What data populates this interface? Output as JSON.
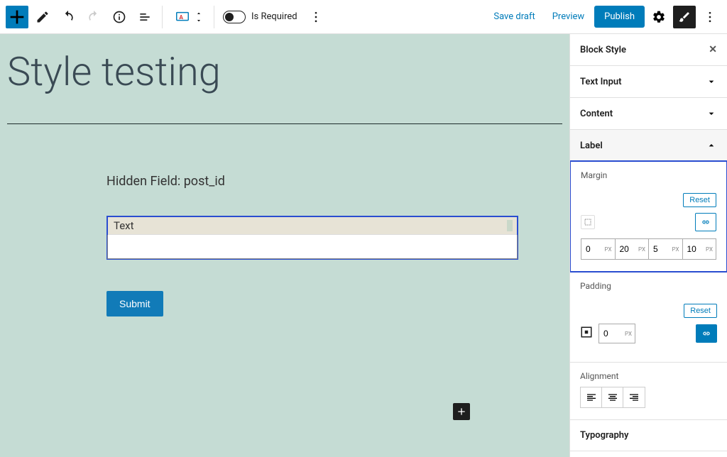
{
  "topbar": {
    "is_required_label": "Is Required",
    "save_draft": "Save draft",
    "preview": "Preview",
    "publish": "Publish"
  },
  "canvas": {
    "page_title": "Style testing",
    "hidden_field": "Hidden Field: post_id",
    "text_label": "Text",
    "submit": "Submit"
  },
  "sidebar": {
    "title": "Block Style",
    "panels": {
      "text_input": "Text Input",
      "content": "Content",
      "label": "Label",
      "margin": "Margin",
      "padding": "Padding",
      "alignment": "Alignment",
      "typography": "Typography"
    },
    "reset": "Reset",
    "margin_values": {
      "top": "0",
      "right": "20",
      "bottom": "5",
      "left": "10",
      "unit": "PX"
    },
    "padding_value": "0",
    "padding_unit": "PX"
  }
}
